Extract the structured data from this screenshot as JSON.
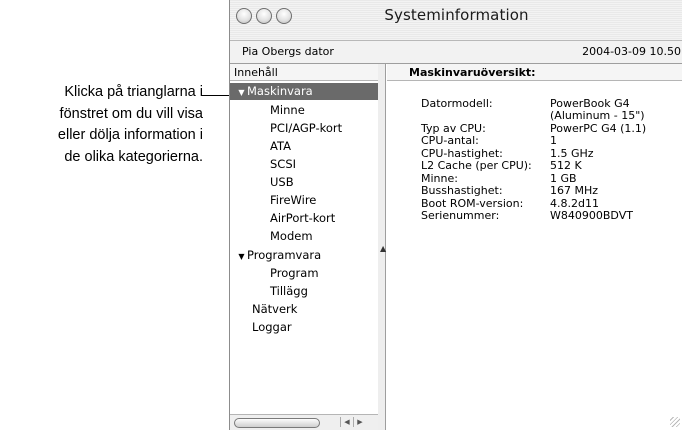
{
  "callout": {
    "lines": [
      "Klicka på trianglarna i",
      "fönstret om du vill visa",
      "eller dölja information i",
      "de olika kategorierna."
    ]
  },
  "window": {
    "title": "Systeminformation",
    "computer_name": "Pia Obergs dator",
    "timestamp": "2004-03-09 10.50"
  },
  "sidebar": {
    "header": "Innehåll",
    "items": [
      {
        "label": "Maskinvara",
        "triangle": "▼",
        "selected": true
      },
      {
        "label": "Minne"
      },
      {
        "label": "PCI/AGP-kort"
      },
      {
        "label": "ATA"
      },
      {
        "label": "SCSI"
      },
      {
        "label": "USB"
      },
      {
        "label": "FireWire"
      },
      {
        "label": "AirPort-kort"
      },
      {
        "label": "Modem"
      },
      {
        "label": "Programvara",
        "triangle": "▼"
      },
      {
        "label": "Program"
      },
      {
        "label": "Tillägg"
      },
      {
        "label": "Nätverk"
      },
      {
        "label": "Loggar"
      }
    ]
  },
  "main": {
    "header": "Maskinvaruöversikt:",
    "rows": [
      {
        "key": "Datormodell:",
        "value": "PowerBook G4"
      },
      {
        "key": "",
        "value": "(Aluminum - 15\")"
      },
      {
        "key": "Typ av CPU:",
        "value": "PowerPC G4  (1.1)"
      },
      {
        "key": "CPU-antal:",
        "value": "1"
      },
      {
        "key": "CPU-hastighet:",
        "value": "1.5 GHz"
      },
      {
        "key": "L2 Cache (per CPU):",
        "value": "512 K"
      },
      {
        "key": "Minne:",
        "value": "1 GB"
      },
      {
        "key": "Busshastighet:",
        "value": "167 MHz"
      },
      {
        "key": "Boot ROM-version:",
        "value": "4.8.2d11"
      },
      {
        "key": "Serienummer:",
        "value": "W840900BDVT"
      }
    ]
  },
  "icons": {
    "window_buttons": [
      "close-icon",
      "minimize-icon",
      "zoom-icon"
    ],
    "scroll_left": "◀",
    "scroll_right": "▶",
    "splitter": "▲"
  }
}
